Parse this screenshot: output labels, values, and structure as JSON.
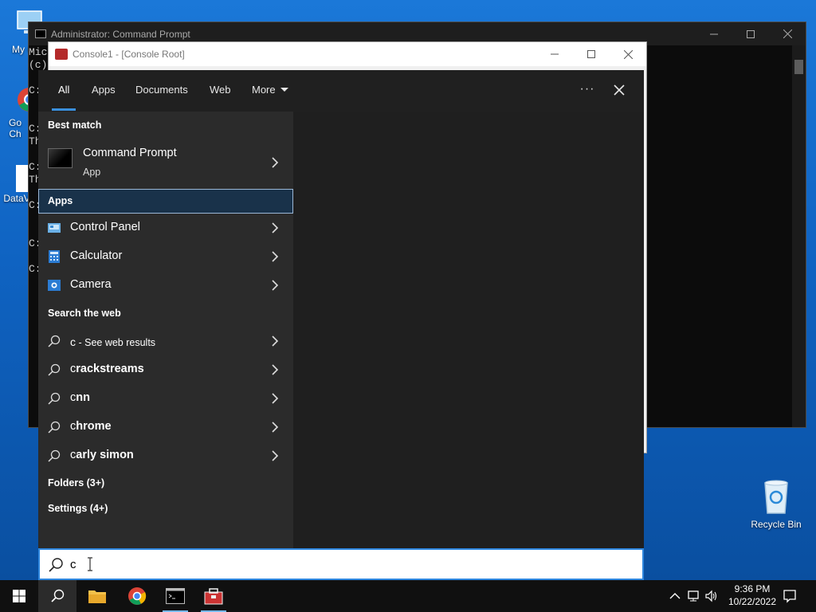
{
  "desktop": {
    "icons": [
      {
        "label": "My C"
      },
      {
        "label": "Go Ch"
      },
      {
        "label": "DataV"
      },
      {
        "label": "Recycle Bin"
      }
    ]
  },
  "cmd_window": {
    "title": "Administrator: Command Prompt",
    "lines": [
      "Mic",
      "(c)",
      "C:",
      "C:",
      "Th",
      "C:",
      "Th",
      "C:",
      "C:",
      "C:"
    ]
  },
  "mmc_window": {
    "title": "Console1 - [Console Root]"
  },
  "search": {
    "tabs": [
      {
        "label": "All",
        "active": true
      },
      {
        "label": "Apps"
      },
      {
        "label": "Documents"
      },
      {
        "label": "Web"
      },
      {
        "label": "More"
      }
    ],
    "more_options_label": "···",
    "best_match_heading": "Best match",
    "best_match": {
      "name": "Command Prompt",
      "type": "App"
    },
    "apps_heading": "Apps",
    "apps": [
      {
        "label": "Control Panel",
        "icon": "control-panel-icon"
      },
      {
        "label": "Calculator",
        "icon": "calculator-icon"
      },
      {
        "label": "Camera",
        "icon": "camera-icon"
      }
    ],
    "web_heading": "Search the web",
    "web_first": {
      "prefix": "c",
      "rest": " - See web results"
    },
    "web_suggestions": [
      {
        "bold": "c",
        "rest": "rackstreams"
      },
      {
        "bold": "c",
        "rest": "nn"
      },
      {
        "bold": "c",
        "rest": "hrome"
      },
      {
        "bold": "c",
        "rest": "arly simon"
      }
    ],
    "folders_heading": "Folders (3+)",
    "settings_heading": "Settings (4+)",
    "query": "c"
  },
  "taskbar": {
    "time": "9:36 PM",
    "date": "10/22/2022"
  },
  "colors": {
    "accent": "#3a8fdc",
    "panel": "#202020",
    "results": "#2b2b2b",
    "selected": "#19324a"
  }
}
